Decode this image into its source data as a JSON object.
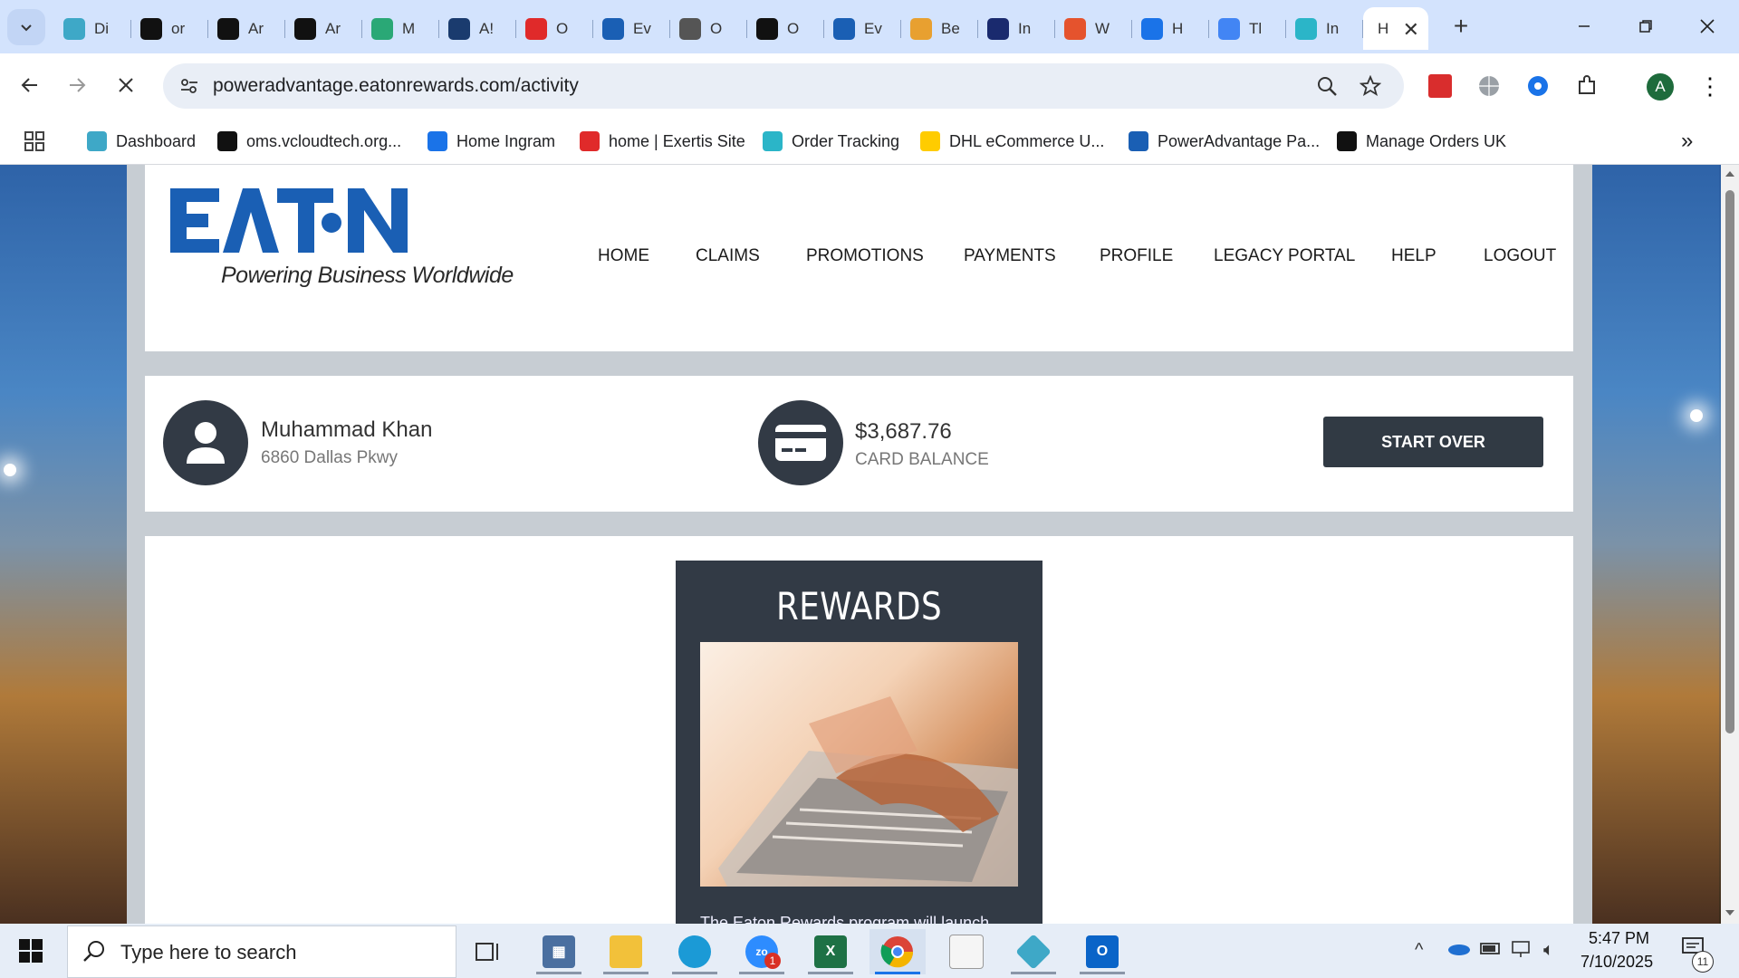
{
  "browser": {
    "tabs": [
      {
        "title": "Di",
        "icon": "hexagon-icon",
        "color": "#3ea8c7"
      },
      {
        "title": "or",
        "icon": "triangle-icon",
        "color": "#111111"
      },
      {
        "title": "Ar",
        "icon": "amazon-icon",
        "color": "#111111"
      },
      {
        "title": "Ar",
        "icon": "amazon-icon",
        "color": "#111111"
      },
      {
        "title": "M",
        "icon": "leaf-icon",
        "color": "#2aa876"
      },
      {
        "title": "A!",
        "icon": "play-icon",
        "color": "#1a3b6e"
      },
      {
        "title": "O",
        "icon": "exertis-icon",
        "color": "#e02a2a"
      },
      {
        "title": "Ev",
        "icon": "eaton-e-icon",
        "color": "#1a5fb4"
      },
      {
        "title": "O",
        "icon": "openai-icon",
        "color": "#555555"
      },
      {
        "title": "O",
        "icon": "openai-icon",
        "color": "#111111"
      },
      {
        "title": "Ev",
        "icon": "eaton-e-icon",
        "color": "#1a5fb4"
      },
      {
        "title": "Be",
        "icon": "bulb-icon",
        "color": "#e8a030"
      },
      {
        "title": "In",
        "icon": "bu-icon",
        "color": "#1a2a6e"
      },
      {
        "title": "W",
        "icon": "stack-icon",
        "color": "#e5532d"
      },
      {
        "title": "H",
        "icon": "ingram-icon",
        "color": "#1a73e8"
      },
      {
        "title": "Tl",
        "icon": "google-icon",
        "color": "#4285f4"
      },
      {
        "title": "In",
        "icon": "c-icon",
        "color": "#2bb5c8"
      }
    ],
    "active_tab": {
      "title": "H",
      "close": "✕"
    },
    "new_tab": "+",
    "url": "poweradvantage.eatonrewards.com/activity",
    "bookmarks": [
      {
        "label": "Dashboard",
        "icon": "hexagon-icon",
        "color": "#3ea8c7"
      },
      {
        "label": "oms.vcloudtech.org...",
        "icon": "triangle-icon",
        "color": "#111111"
      },
      {
        "label": "Home Ingram",
        "icon": "ingram-icon",
        "color": "#1a73e8"
      },
      {
        "label": "home | Exertis Site",
        "icon": "exertis-icon",
        "color": "#e02a2a"
      },
      {
        "label": "Order Tracking",
        "icon": "c-icon",
        "color": "#2bb5c8"
      },
      {
        "label": "DHL eCommerce U...",
        "icon": "dhl-icon",
        "color": "#ffcc00"
      },
      {
        "label": "PowerAdvantage Pa...",
        "icon": "doc-icon",
        "color": "#1a5fb4"
      },
      {
        "label": "Manage Orders UK",
        "icon": "amazon-icon",
        "color": "#111111"
      }
    ],
    "profile_letter": "A"
  },
  "site": {
    "brand": "EAT·N",
    "tagline": "Powering Business Worldwide",
    "nav": [
      "HOME",
      "CLAIMS",
      "PROMOTIONS",
      "PAYMENTS",
      "PROFILE",
      "LEGACY PORTAL",
      "HELP",
      "LOGOUT"
    ],
    "user": {
      "name": "Muhammad Khan",
      "address": "6860 Dallas Pkwy"
    },
    "balance": {
      "amount": "$3,687.76",
      "label": "CARD BALANCE"
    },
    "start_over": "START OVER",
    "rewards": {
      "title": "REWARDS",
      "text": "The Eaton Rewards program will launch"
    },
    "colors": {
      "brand_blue": "#1a5fb4",
      "dark_panel": "#323a45"
    }
  },
  "taskbar": {
    "search_placeholder": "Type here to search",
    "zoom_badge": "1",
    "notifications": "11",
    "time": "5:47 PM",
    "date": "7/10/2025"
  }
}
